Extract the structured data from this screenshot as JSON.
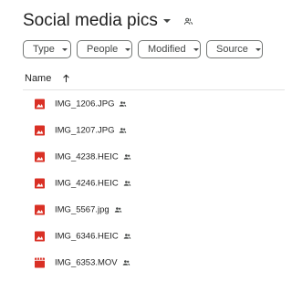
{
  "header": {
    "title": "Social media pics",
    "title_menu_icon": "caret-down-icon",
    "shared_icon": "shared-folder-icon"
  },
  "filters": [
    {
      "label": "Type"
    },
    {
      "label": "People"
    },
    {
      "label": "Modified"
    },
    {
      "label": "Source"
    }
  ],
  "columns": {
    "name_label": "Name",
    "sort_icon": "arrow-up-icon"
  },
  "files": [
    {
      "name": "IMG_1206.JPG",
      "kind": "image",
      "shared": true
    },
    {
      "name": "IMG_1207.JPG",
      "kind": "image",
      "shared": true
    },
    {
      "name": "IMG_4238.HEIC",
      "kind": "image",
      "shared": true
    },
    {
      "name": "IMG_4246.HEIC",
      "kind": "image",
      "shared": true
    },
    {
      "name": "IMG_5567.jpg",
      "kind": "image",
      "shared": true
    },
    {
      "name": "IMG_6346.HEIC",
      "kind": "image",
      "shared": true
    },
    {
      "name": "IMG_6353.MOV",
      "kind": "video",
      "shared": true
    }
  ],
  "colors": {
    "file_icon_red": "#d93025",
    "text": "#1f1f1f",
    "muted": "#444746",
    "divider": "#e3e3e3"
  }
}
